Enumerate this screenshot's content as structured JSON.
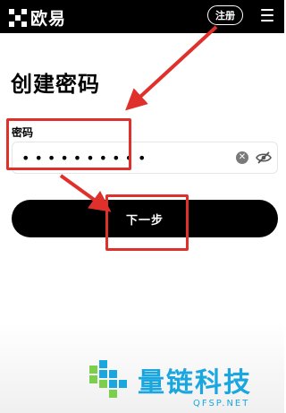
{
  "app": {
    "brand": "欧易",
    "register_label": "注册"
  },
  "icons": [
    "okx-logo-icon",
    "menu-icon",
    "clear-icon",
    "eye-slash-icon"
  ],
  "page": {
    "title": "创建密码",
    "password_label": "密码",
    "password_value_masked": "••••••••••",
    "next_label": "下一步"
  },
  "watermark": {
    "title": "量链科技",
    "subtitle": "QFSP.NET"
  },
  "colors": {
    "topbar_bg": "#000000",
    "primary_button": "#000000",
    "annotation_red": "#e0302b",
    "watermark_blue": "#1aa7e0",
    "watermark_green": "#7ccf4a"
  }
}
